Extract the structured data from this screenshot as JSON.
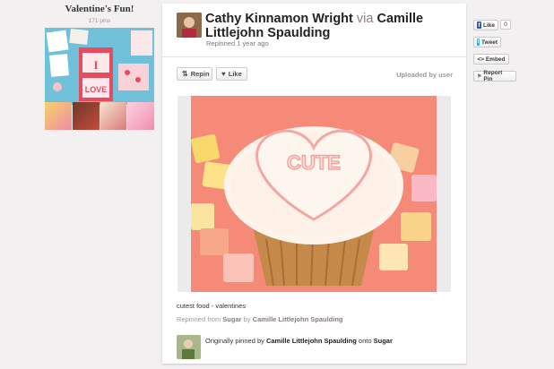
{
  "board": {
    "title": "Valentine's Fun!",
    "pins": "171 pins"
  },
  "pin": {
    "pinner_name": "Cathy Kinnamon Wright",
    "via": "via",
    "source_name": "Camille Littlejohn Spaulding",
    "repinned_time": "Repinned 1 year ago",
    "repin_label": "Repin",
    "like_label": "Like",
    "uploaded": "Uploaded by user",
    "image_text": "CUTE",
    "description": "cutest food - valentines",
    "repinned_from_prefix": "Repinned from",
    "repinned_from_board": "Sugar",
    "repinned_from_by": "by",
    "repinned_from_user": "Camille Littlejohn Spaulding",
    "orig_prefix": "Originally pinned by",
    "orig_user": "Camille Littlejohn Spaulding",
    "orig_onto": "onto",
    "orig_board": "Sugar"
  },
  "share": {
    "fb_label": "Like",
    "fb_count": "0",
    "tweet_label": "Tweet",
    "embed_label": "<> Embed",
    "report_label": "Report Pin"
  },
  "colors": {
    "background": "#f2f0f0",
    "card": "#ffffff",
    "facebook": "#3b5998",
    "twitter": "#2aa9e0",
    "image_bg": "#f58a78"
  },
  "icons": [
    "pin-icon",
    "heart-icon",
    "facebook-icon",
    "twitter-icon",
    "flag-icon"
  ]
}
